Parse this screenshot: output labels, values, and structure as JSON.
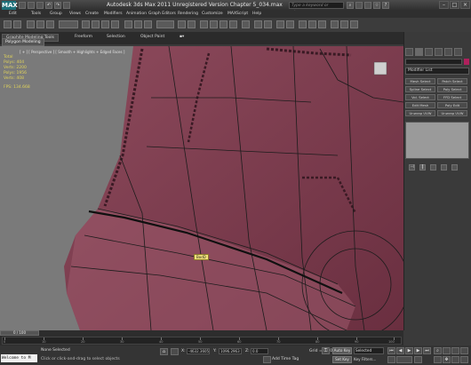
{
  "titlebar": {
    "logo": "MAX",
    "title": "Autodesk 3ds Max 2011   Unregistered Version   Chapter 5_034.max",
    "search_placeholder": "Type a keyword or phrase"
  },
  "menu": [
    "Edit",
    "Tools",
    "Group",
    "Views",
    "Create",
    "Modifiers",
    "Animation",
    "Graph Editors",
    "Rendering",
    "Customize",
    "MAXScript",
    "Help"
  ],
  "ribbon": {
    "tabs": [
      "Graphite Modeling Tools",
      "Freeform",
      "Selection",
      "Object Paint"
    ],
    "sub_tab": "Polygon Modeling"
  },
  "viewport": {
    "label": "[ + ] [ Perspective ] [ Smooth + Highlights + Edged Faces ]",
    "stats": [
      {
        "k": "Total",
        "v": ""
      },
      {
        "k": "Polys:",
        "v": "404"
      },
      {
        "k": "Verts:",
        "v": "2200"
      },
      {
        "k": "Polys:",
        "v": "1956"
      },
      {
        "k": "Verts:",
        "v": "408"
      },
      {
        "k": "FPS:",
        "v": "134.668"
      }
    ],
    "label_tag": "BodD"
  },
  "command_panel": {
    "modifier_list": "Modifier List",
    "buttons": [
      "Mesh Select",
      "Patch Select",
      "Spline Select",
      "Poly Select",
      "Vol. Select",
      "FFD Select",
      "Edit Mesh",
      "Poly Edit",
      "Unwrap UVW",
      "Unwrap UVW"
    ]
  },
  "timeline": {
    "slider": "0 / 100",
    "ticks": [
      "0",
      "10",
      "20",
      "30",
      "40",
      "50",
      "60",
      "70",
      "80",
      "90",
      "100"
    ]
  },
  "status": {
    "maxscript": "Welcome to M",
    "line1": "None Selected",
    "line2": "Click or click-and-drag to select objects",
    "x_label": "X:",
    "x_value": "-4632.3605",
    "y_label": "Y:",
    "y_value": "1096.2963",
    "z_label": "Z:",
    "z_value": "0.0",
    "grid": "Grid = 10.0",
    "add_time_tag": "Add Time Tag",
    "auto_key": "Auto Key",
    "set_key": "Set Key",
    "selected": "Selected",
    "key_filters": "Key Filters..."
  }
}
